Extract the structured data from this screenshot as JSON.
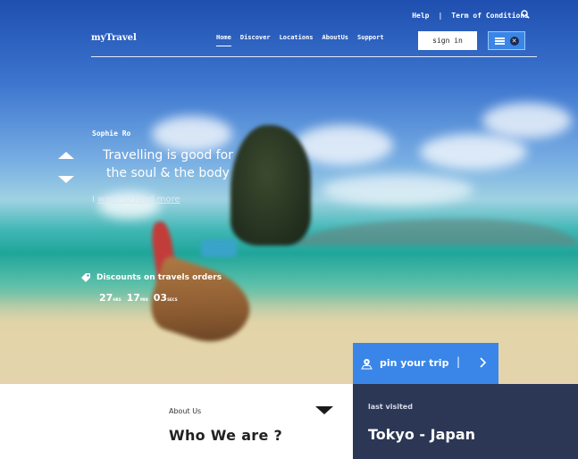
{
  "header": {
    "help_label": "Help",
    "divider": "|",
    "terms_label": "Term of Conditions",
    "logo": "myTravel",
    "nav": [
      {
        "label": "Home",
        "active": true
      },
      {
        "label": "Discover",
        "active": false
      },
      {
        "label": "Locations",
        "active": false
      },
      {
        "label": "AboutUs",
        "active": false
      },
      {
        "label": "Support",
        "active": false
      }
    ],
    "signin_label": "sign in",
    "menu_icon": "hamburger-icon",
    "close_icon": "close-icon",
    "search_icon": "search-icon"
  },
  "hero": {
    "author": "Sophie Ro",
    "headline": "Travelling is good for the soul & the body",
    "read_more_prefix": "I ",
    "read_more_link": "want to read more",
    "discount_label": "Discounts on travels orders",
    "countdown": [
      {
        "value": "27",
        "unit": "HRS"
      },
      {
        "value": "17",
        "unit": "MIN"
      },
      {
        "value": "03",
        "unit": "SECS"
      }
    ],
    "accent_color": "#3a86e8"
  },
  "pin": {
    "label": "pin your trip",
    "separator": "|",
    "icon": "map-pin-icon",
    "chevron": "chevron-right-icon"
  },
  "about": {
    "label": "About Us",
    "title": "Who We are ?"
  },
  "visited": {
    "label": "last visited",
    "city": "Tokyo - Japan",
    "bg_color": "#2c3755"
  }
}
